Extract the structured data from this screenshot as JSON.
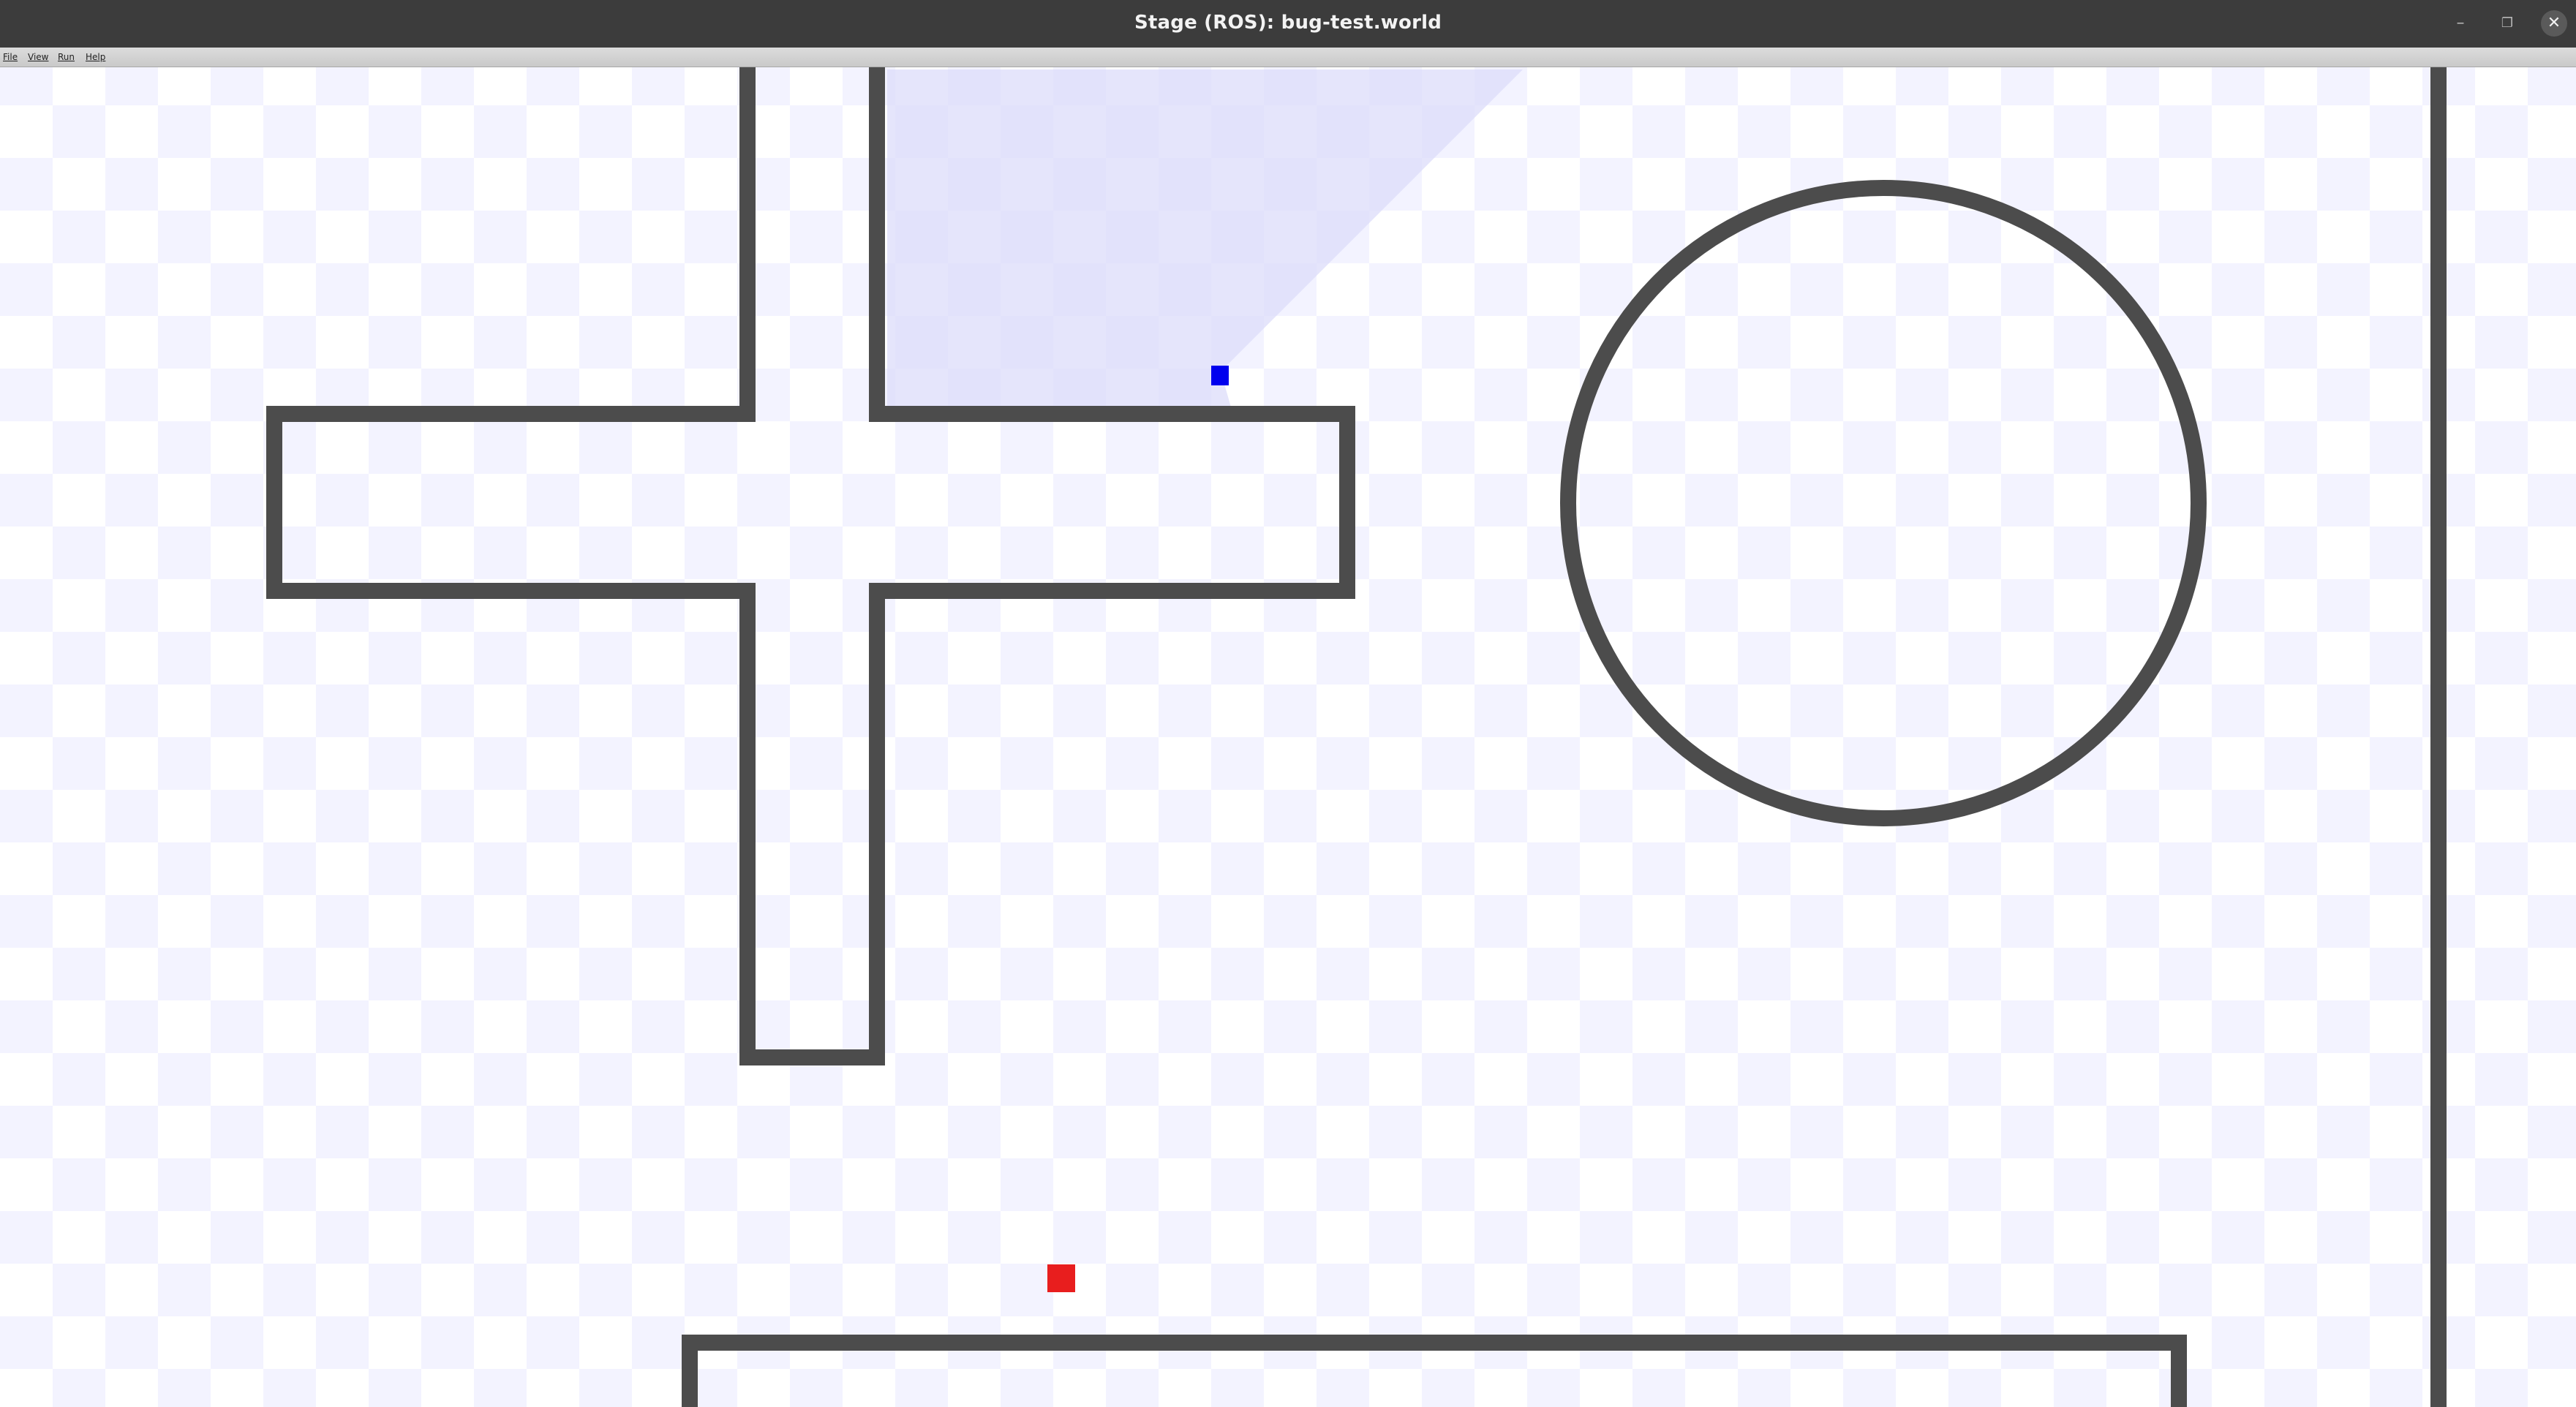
{
  "window": {
    "title": "Stage (ROS): bug-test.world",
    "controls": {
      "minimize_glyph": "–",
      "maximize_glyph": "❐",
      "close_glyph": "✕"
    }
  },
  "menubar": {
    "items": [
      {
        "label": "File"
      },
      {
        "label": "View"
      },
      {
        "label": "Run"
      },
      {
        "label": "Help"
      }
    ]
  },
  "world": {
    "background_color": "#ffffff",
    "checker_color": "#f3f3ff",
    "obstacle_color": "#4c4c4c",
    "laser_fov_color": "#dcdcfa",
    "robot": {
      "name": "robot",
      "color": "#0000ee",
      "shape": "square"
    },
    "goal": {
      "name": "goal",
      "color": "#e81e1e",
      "shape": "square"
    }
  }
}
